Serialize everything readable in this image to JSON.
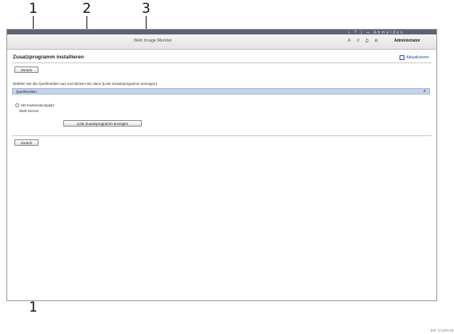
{
  "callouts": {
    "n1": "1",
    "n2": "2",
    "n3": "3",
    "n1_bottom": "1"
  },
  "header": {
    "app_title": "Web Image Monitor",
    "icons_text": "⌕ ? | ⇥ Abmelden",
    "controls_text": "A ↺ ⎙ ⊞",
    "user": "Administrator"
  },
  "page": {
    "title": "Zusatzprogramm installieren",
    "help": "Aktualisieren",
    "back_label": "Zurück",
    "instruction": "Wählen Sie die Quellmedien aus und klicken Sie dann [Liste Zusatzprogramm anzeigen].",
    "section_title": "Quellmedien",
    "collapse": "∧",
    "options": [
      "SD-Kartensteckplatz",
      "Web-Server"
    ],
    "list_button": "Liste Zusatzprogramm anzeigen",
    "back_label_bottom": "Zurück"
  },
  "figure_code": "DE CUR019"
}
